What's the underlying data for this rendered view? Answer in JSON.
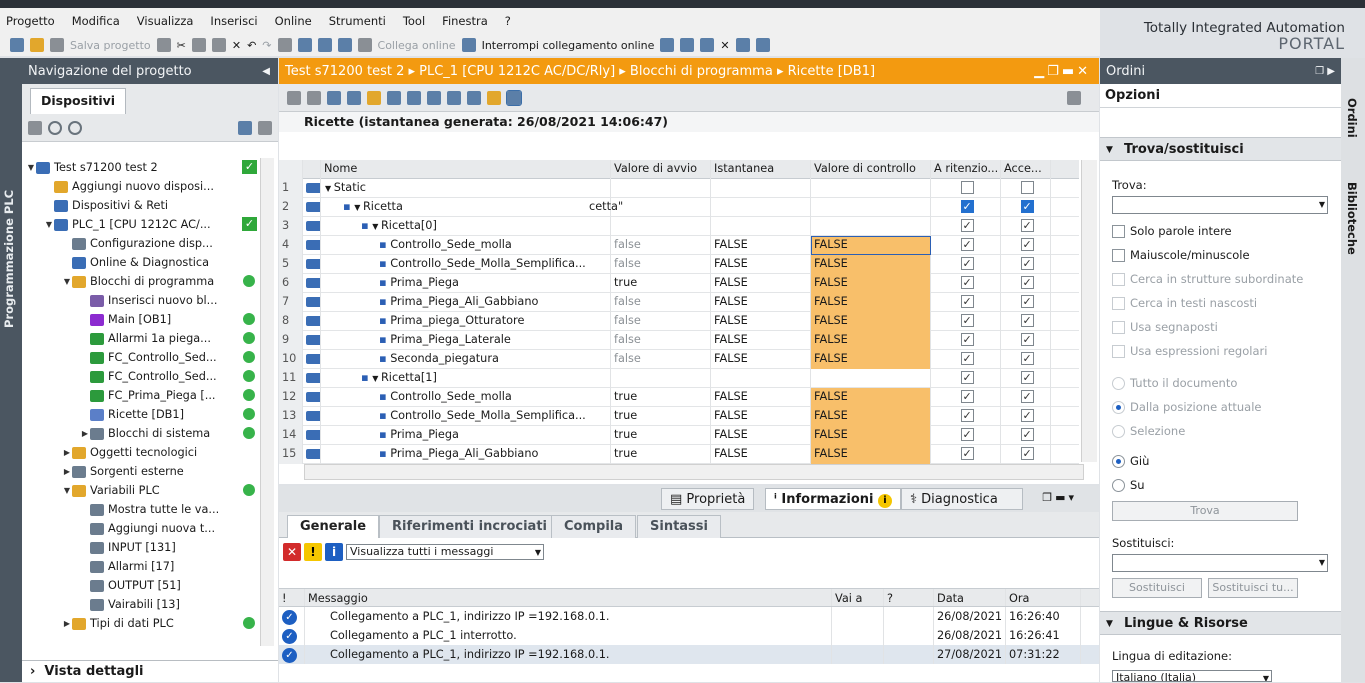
{
  "menu": [
    "Progetto",
    "Modifica",
    "Visualizza",
    "Inserisci",
    "Online",
    "Strumenti",
    "Tool",
    "Finestra",
    "?"
  ],
  "toolbar": {
    "save_label": "Salva progetto",
    "connect_label": "Collega online",
    "disconnect_label": "Interrompi collegamento online"
  },
  "brand": {
    "line1": "Totally Integrated Automation",
    "line2": "PORTAL"
  },
  "sidebar_left_label": "Programmazione PLC",
  "nav": {
    "title": "Navigazione del progetto",
    "tab": "Dispositivi",
    "items": [
      {
        "label": "Test s71200 test 2",
        "indent": 0,
        "toggle": "▼",
        "status": "check"
      },
      {
        "label": "Aggiungi nuovo disposi...",
        "indent": 1,
        "toggle": "",
        "status": ""
      },
      {
        "label": "Dispositivi & Reti",
        "indent": 1,
        "toggle": "",
        "status": ""
      },
      {
        "label": "PLC_1 [CPU 1212C AC/...",
        "indent": 1,
        "toggle": "▼",
        "status": "check"
      },
      {
        "label": "Configurazione disp...",
        "indent": 2,
        "toggle": "",
        "status": ""
      },
      {
        "label": "Online & Diagnostica",
        "indent": 2,
        "toggle": "",
        "status": ""
      },
      {
        "label": "Blocchi di programma",
        "indent": 2,
        "toggle": "▼",
        "status": "ok"
      },
      {
        "label": "Inserisci nuovo bl...",
        "indent": 3,
        "toggle": "",
        "status": ""
      },
      {
        "label": "Main [OB1]",
        "indent": 3,
        "toggle": "",
        "status": "ok"
      },
      {
        "label": "Allarmi 1a piega...",
        "indent": 3,
        "toggle": "",
        "status": "ok"
      },
      {
        "label": "FC_Controllo_Sed...",
        "indent": 3,
        "toggle": "",
        "status": "ok"
      },
      {
        "label": "FC_Controllo_Sed...",
        "indent": 3,
        "toggle": "",
        "status": "ok"
      },
      {
        "label": "FC_Prima_Piega [...",
        "indent": 3,
        "toggle": "",
        "status": "ok"
      },
      {
        "label": "Ricette [DB1]",
        "indent": 3,
        "toggle": "",
        "status": "ok"
      },
      {
        "label": "Blocchi di sistema",
        "indent": 3,
        "toggle": "▶",
        "status": "ok"
      },
      {
        "label": "Oggetti tecnologici",
        "indent": 2,
        "toggle": "▶",
        "status": ""
      },
      {
        "label": "Sorgenti esterne",
        "indent": 2,
        "toggle": "▶",
        "status": ""
      },
      {
        "label": "Variabili PLC",
        "indent": 2,
        "toggle": "▼",
        "status": "ok"
      },
      {
        "label": "Mostra tutte le va...",
        "indent": 3,
        "toggle": "",
        "status": ""
      },
      {
        "label": "Aggiungi nuova t...",
        "indent": 3,
        "toggle": "",
        "status": ""
      },
      {
        "label": "INPUT [131]",
        "indent": 3,
        "toggle": "",
        "status": ""
      },
      {
        "label": "Allarmi [17]",
        "indent": 3,
        "toggle": "",
        "status": ""
      },
      {
        "label": "OUTPUT [51]",
        "indent": 3,
        "toggle": "",
        "status": ""
      },
      {
        "label": "Vairabili [13]",
        "indent": 3,
        "toggle": "",
        "status": ""
      },
      {
        "label": "Tipi di dati PLC",
        "indent": 2,
        "toggle": "▶",
        "status": "ok"
      }
    ],
    "details": "Vista dettagli"
  },
  "editor": {
    "breadcrumb": "Test s71200 test 2  ▸  PLC_1 [CPU 1212C AC/DC/Rly]  ▸  Blocchi di programma  ▸  Ricette [DB1]",
    "title": "Ricette (istantanea generata: 26/08/2021 14:06:47)",
    "columns": {
      "name": "Nome",
      "start": "Valore di avvio",
      "snapshot": "Istantanea",
      "control": "Valore di controllo",
      "retain": "A ritenzio...",
      "access": "Acce..."
    },
    "rows": [
      {
        "n": "1",
        "lvl": 0,
        "tg": "▼",
        "dot": false,
        "name": "Static",
        "start": "",
        "snap": "",
        "ctl": "",
        "retain": "empty",
        "access": "empty",
        "extra": ""
      },
      {
        "n": "2",
        "lvl": 1,
        "tg": "▼",
        "dot": true,
        "name": "Ricetta",
        "start": "",
        "snap": "",
        "ctl": "",
        "retain": "blue",
        "access": "blue",
        "extra": "cetta\""
      },
      {
        "n": "3",
        "lvl": 2,
        "tg": "▼",
        "dot": true,
        "name": "Ricetta[0]",
        "start": "",
        "snap": "",
        "ctl": "",
        "retain": "on",
        "access": "on",
        "extra": ""
      },
      {
        "n": "4",
        "lvl": 3,
        "tg": "",
        "dot": true,
        "name": "Controllo_Sede_molla",
        "start": "false",
        "snap": "FALSE",
        "ctl": "FALSE",
        "retain": "on",
        "access": "on",
        "extra": ""
      },
      {
        "n": "5",
        "lvl": 3,
        "tg": "",
        "dot": true,
        "name": "Controllo_Sede_Molla_Semplifica...",
        "start": "false",
        "snap": "FALSE",
        "ctl": "FALSE",
        "retain": "on",
        "access": "on",
        "extra": ""
      },
      {
        "n": "6",
        "lvl": 3,
        "tg": "",
        "dot": true,
        "name": "Prima_Piega",
        "start": "true",
        "snap": "FALSE",
        "ctl": "FALSE",
        "retain": "on",
        "access": "on",
        "extra": ""
      },
      {
        "n": "7",
        "lvl": 3,
        "tg": "",
        "dot": true,
        "name": "Prima_Piega_Ali_Gabbiano",
        "start": "false",
        "snap": "FALSE",
        "ctl": "FALSE",
        "retain": "on",
        "access": "on",
        "extra": ""
      },
      {
        "n": "8",
        "lvl": 3,
        "tg": "",
        "dot": true,
        "name": "Prima_piega_Otturatore",
        "start": "false",
        "snap": "FALSE",
        "ctl": "FALSE",
        "retain": "on",
        "access": "on",
        "extra": ""
      },
      {
        "n": "9",
        "lvl": 3,
        "tg": "",
        "dot": true,
        "name": "Prima_Piega_Laterale",
        "start": "false",
        "snap": "FALSE",
        "ctl": "FALSE",
        "retain": "on",
        "access": "on",
        "extra": ""
      },
      {
        "n": "10",
        "lvl": 3,
        "tg": "",
        "dot": true,
        "name": "Seconda_piegatura",
        "start": "false",
        "snap": "FALSE",
        "ctl": "FALSE",
        "retain": "on",
        "access": "on",
        "extra": ""
      },
      {
        "n": "11",
        "lvl": 2,
        "tg": "▼",
        "dot": true,
        "name": "Ricetta[1]",
        "start": "",
        "snap": "",
        "ctl": "",
        "retain": "on",
        "access": "on",
        "extra": ""
      },
      {
        "n": "12",
        "lvl": 3,
        "tg": "",
        "dot": true,
        "name": "Controllo_Sede_molla",
        "start": "true",
        "snap": "FALSE",
        "ctl": "FALSE",
        "retain": "on",
        "access": "on",
        "extra": ""
      },
      {
        "n": "13",
        "lvl": 3,
        "tg": "",
        "dot": true,
        "name": "Controllo_Sede_Molla_Semplifica...",
        "start": "true",
        "snap": "FALSE",
        "ctl": "FALSE",
        "retain": "on",
        "access": "on",
        "extra": ""
      },
      {
        "n": "14",
        "lvl": 3,
        "tg": "",
        "dot": true,
        "name": "Prima_Piega",
        "start": "true",
        "snap": "FALSE",
        "ctl": "FALSE",
        "retain": "on",
        "access": "on",
        "extra": ""
      },
      {
        "n": "15",
        "lvl": 3,
        "tg": "",
        "dot": true,
        "name": "Prima_Piega_Ali_Gabbiano",
        "start": "true",
        "snap": "FALSE",
        "ctl": "FALSE",
        "retain": "on",
        "access": "on",
        "extra": ""
      }
    ]
  },
  "inspector": {
    "tabs": [
      "Proprietà",
      "Informazioni",
      "Diagnostica"
    ],
    "subtabs": [
      "Generale",
      "Riferimenti incrociati",
      "Compila",
      "Sintassi"
    ],
    "filter": "Visualizza tutti i messaggi",
    "columns": {
      "bang": "!",
      "msg": "Messaggio",
      "goto": "Vai a",
      "q": "?",
      "date": "Data",
      "time": "Ora"
    },
    "messages": [
      {
        "msg": "Collegamento a PLC_1, indirizzo IP =192.168.0.1.",
        "date": "26/08/2021",
        "time": "16:26:40"
      },
      {
        "msg": "Collegamento a PLC_1 interrotto.",
        "date": "26/08/2021",
        "time": "16:26:41"
      },
      {
        "msg": "Collegamento a PLC_1, indirizzo IP =192.168.0.1.",
        "date": "27/08/2021",
        "time": "07:31:22"
      }
    ]
  },
  "right": {
    "title": "Ordini",
    "options": "Opzioni",
    "find_section": "Trova/sostituisci",
    "find_label": "Trova:",
    "checks": [
      "Solo parole intere",
      "Maiuscole/minuscole",
      "Cerca in strutture subordinate",
      "Cerca in testi nascosti",
      "Usa segnaposti",
      "Usa espressioni regolari"
    ],
    "radios1": [
      "Tutto il documento",
      "Dalla posizione attuale",
      "Selezione"
    ],
    "radios2": [
      "Giù",
      "Su"
    ],
    "find_btn": "Trova",
    "replace_label": "Sostituisci:",
    "replace_btn": "Sostituisci",
    "replace_all_btn": "Sostituisci tu...",
    "lang_section": "Lingue & Risorse",
    "lang_label": "Lingua di editazione:",
    "lang_value": "Italiano (Italia)",
    "strip": [
      "Ordini",
      "Biblioteche"
    ]
  },
  "colors": {
    "accent": "#f39a10",
    "panel_header": "#4b5661",
    "control_cell": "#f8bf6a",
    "ok": "#37b34a"
  }
}
